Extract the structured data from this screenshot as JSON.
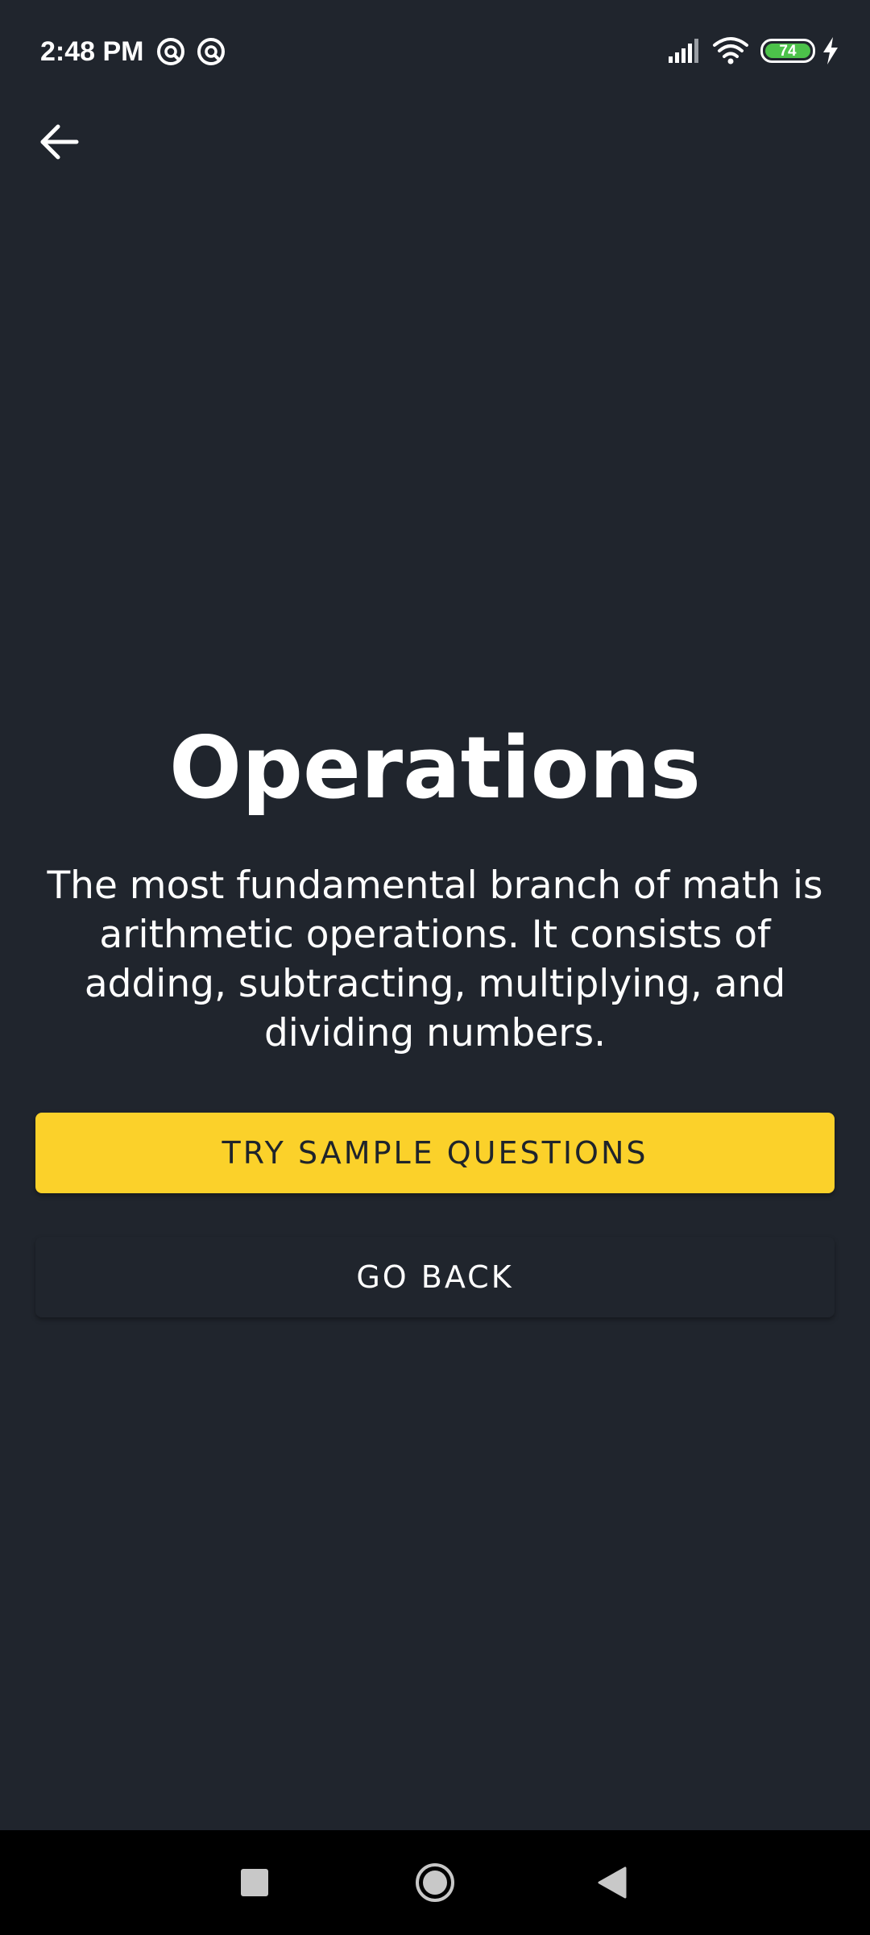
{
  "status_bar": {
    "time": "2:48 PM",
    "notification_icons": [
      "app-notification-icon",
      "app-notification-icon"
    ],
    "signal_icon": "cellular-signal-icon",
    "wifi_icon": "wifi-icon",
    "battery_level": "74",
    "battery_color": "#4cc24a",
    "charging_icon": "charging-bolt-icon"
  },
  "header": {
    "back_icon": "arrow-left-icon"
  },
  "main": {
    "title": "Operations",
    "description": "The most fundamental branch of math is arithmetic operations. It consists of adding, subtracting, multiplying, and dividing numbers.",
    "primary_button_label": "TRY SAMPLE QUESTIONS",
    "secondary_button_label": "GO BACK"
  },
  "colors": {
    "background": "#20252d",
    "accent": "#fbd12a",
    "primary_button_text": "#1f242b",
    "text": "#ffffff"
  },
  "nav_bar": {
    "recents_icon": "square-recents-icon",
    "home_icon": "circle-home-icon",
    "back_icon": "triangle-back-icon"
  }
}
